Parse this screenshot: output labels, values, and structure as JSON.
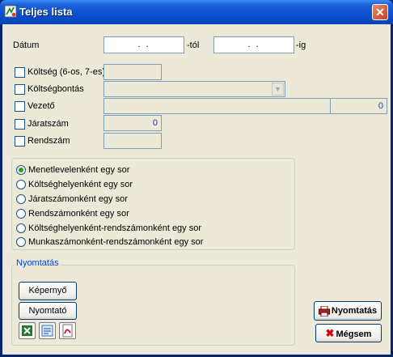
{
  "window": {
    "title": "Teljes lista",
    "close_glyph": "✕"
  },
  "date": {
    "label": "Dátum",
    "from_value": ".  .",
    "from_suffix": "-tól",
    "to_value": ".  .",
    "to_suffix": "-ig"
  },
  "filters": {
    "koltseg": {
      "label": "Költség (6-os, 7-es)"
    },
    "koltsegbontas": {
      "label": "Költségbontás"
    },
    "vezeto": {
      "label": "Vezető",
      "count": "0"
    },
    "jaratszam": {
      "label": "Járatszám",
      "value": "0"
    },
    "rendszam": {
      "label": "Rendszám"
    }
  },
  "grouping": {
    "options": [
      {
        "label": "Menetlevelenként egy sor",
        "selected": true
      },
      {
        "label": "Költséghelyenként egy sor",
        "selected": false
      },
      {
        "label": "Járatszámonként egy sor",
        "selected": false
      },
      {
        "label": "Rendszámonként egy sor",
        "selected": false
      },
      {
        "label": "Költséghelyenként-rendszámonként egy sor",
        "selected": false
      },
      {
        "label": "Munkaszámonként-rendszámonként egy sor",
        "selected": false
      }
    ]
  },
  "print": {
    "group_title": "Nyomtatás",
    "screen_label": "Képernyő",
    "printer_label": "Nyomtató",
    "icons": [
      "excel-icon",
      "word-icon",
      "pdf-icon"
    ]
  },
  "actions": {
    "print_label": "Nyomtatás",
    "cancel_label": "Mégsem"
  },
  "colors": {
    "title_bar": "#0a4fd0",
    "client_bg": "#ece9d8",
    "group_title": "#0046d5",
    "radio_dot": "#21a121"
  }
}
